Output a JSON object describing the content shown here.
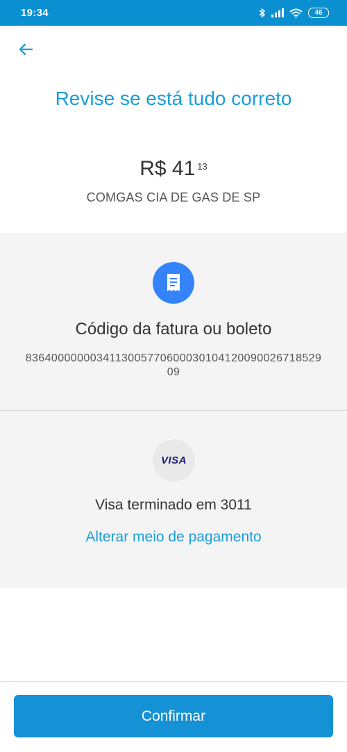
{
  "status_bar": {
    "time": "19:34",
    "battery": "46",
    "icons": [
      "bluetooth-icon",
      "signal-icon",
      "wifi-icon",
      "battery-icon"
    ]
  },
  "header": {
    "back_icon": "arrow-left-icon",
    "title": "Revise se está tudo correto"
  },
  "summary": {
    "currency": "R$",
    "amount_integer": "41",
    "amount_cents": "13",
    "payee": "COMGAS CIA DE GAS DE SP"
  },
  "invoice": {
    "icon": "receipt-icon",
    "label": "Código da fatura ou boleto",
    "barcode": "836400000003411300577060003010412009002671852909"
  },
  "payment": {
    "brand": "VISA",
    "card_label": "Visa terminado em 3011",
    "change_label": "Alterar meio de pagamento"
  },
  "footer": {
    "confirm_label": "Confirmar"
  },
  "colors": {
    "status_bar": "#0a8fd0",
    "accent": "#1b9ed8",
    "primary_button": "#1591d6",
    "invoice_icon_bg": "#3483fa",
    "section_bg": "#f4f4f4",
    "visa_blue": "#1a1f71"
  }
}
